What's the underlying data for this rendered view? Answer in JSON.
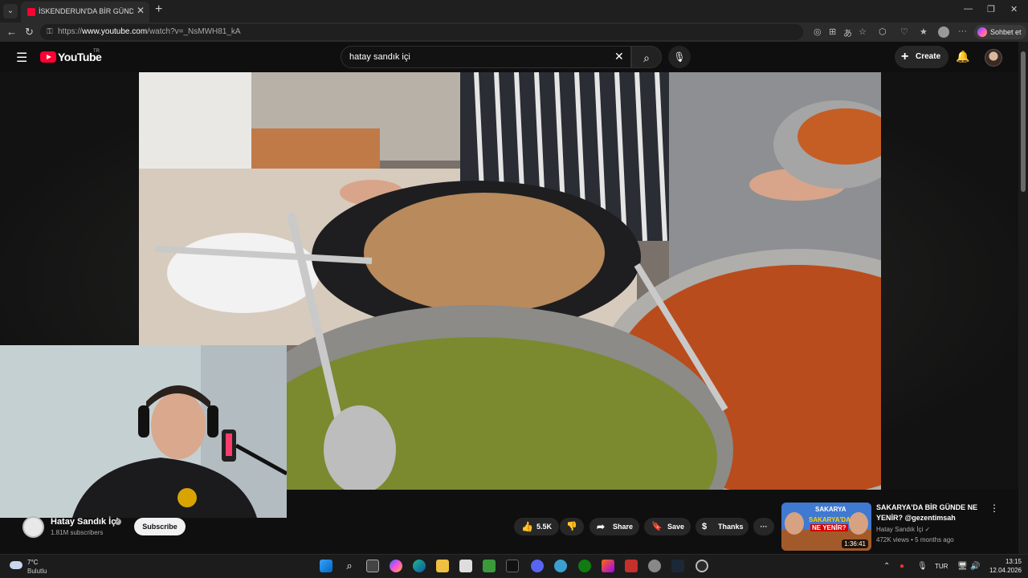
{
  "browser": {
    "tab_title": "İSKENDERUN'DA BİR GÜNDE NE Y",
    "url_prefix": "https://",
    "url_host": "www.youtube.com",
    "url_path": "/watch?v=_NsMWH81_kA",
    "copilot_label": "Sohbet et"
  },
  "youtube": {
    "wordmark": "YouTube",
    "country": "TR",
    "search_query": "hatay sandık içi",
    "create_label": "Create"
  },
  "channel": {
    "name": "Hatay Sandık İçi",
    "subscribers": "1.81M subscribers",
    "subscribe_label": "Subscribe"
  },
  "actions": {
    "likes": "5.5K",
    "share": "Share",
    "save": "Save",
    "thanks": "Thanks"
  },
  "recommended": {
    "title": "SAKARYA'DA BİR GÜNDE NE YENİR? @gezentimsah",
    "channel": "Hatay Sandık İçi",
    "meta": "472K views • 5 months ago",
    "duration": "1:36:41",
    "thumb_text_1": "SAKARYA",
    "thumb_text_2": "SAKARYA'DA",
    "thumb_text_3": "NE YENİR?"
  },
  "taskbar": {
    "temperature": "7°C",
    "weather": "Bulutlu",
    "language": "TUR",
    "time": "13:15",
    "date": "12.04.2026"
  },
  "colors": {
    "youtube_red": "#ff0033",
    "background": "#0f0f0f",
    "pill": "#272727"
  }
}
